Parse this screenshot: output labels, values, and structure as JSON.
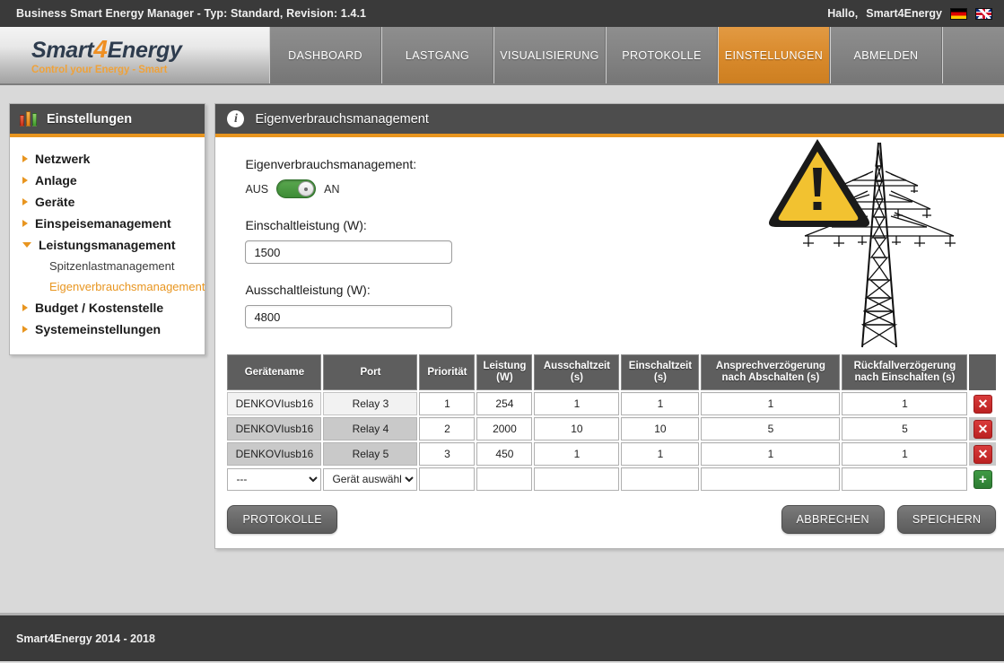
{
  "topbar": {
    "title": "Business Smart Energy Manager - Typ: Standard, Revision: 1.4.1",
    "greeting": "Hallo,",
    "user": "Smart4Energy",
    "flag_de": "german-flag-icon",
    "flag_en": "uk-flag-icon"
  },
  "brand": {
    "name_part1": "Smart",
    "name_four": "4",
    "name_part2": "Energy",
    "tagline": "Control your Energy - Smart"
  },
  "nav": {
    "items": [
      {
        "label": "DASHBOARD",
        "active": false
      },
      {
        "label": "LASTGANG",
        "active": false
      },
      {
        "label": "VISUALISIERUNG",
        "active": false
      },
      {
        "label": "PROTOKOLLE",
        "active": false
      },
      {
        "label": "EINSTELLUNGEN",
        "active": true
      },
      {
        "label": "ABMELDEN",
        "active": false
      }
    ],
    "active_color": "#d98a2c"
  },
  "sidebar": {
    "title": "Einstellungen",
    "icon": "bar-chart-icon",
    "items": [
      {
        "label": "Netzwerk",
        "expanded": false
      },
      {
        "label": "Anlage",
        "expanded": false
      },
      {
        "label": "Geräte",
        "expanded": false
      },
      {
        "label": "Einspeisemanagement",
        "expanded": false
      },
      {
        "label": "Leistungsmanagement",
        "expanded": true
      }
    ],
    "subitems": [
      {
        "label": "Spitzenlastmanagement",
        "active": false
      },
      {
        "label": "Eigenverbrauchsmanagement",
        "active": true
      }
    ],
    "items_after": [
      {
        "label": "Budget / Kostenstelle",
        "expanded": false
      },
      {
        "label": "Systemeinstellungen",
        "expanded": false
      }
    ],
    "accent_color": "#e8951f"
  },
  "content": {
    "title": "Eigenverbrauchsmanagement",
    "icon": "info-icon",
    "form": {
      "toggle_label": "Eigenverbrauchsmanagement:",
      "toggle_off": "AUS",
      "toggle_on": "AN",
      "toggle_state": "on",
      "field1_label": "Einschaltleistung (W):",
      "field1_value": "1500",
      "field2_label": "Ausschaltleistung (W):",
      "field2_value": "4800"
    },
    "graphic": {
      "name": "power-pylon-warning-graphic",
      "warning_color": "#f2c230"
    }
  },
  "table": {
    "headers": [
      "Gerätename",
      "Port",
      "Priorität",
      "Leistung\n(W)",
      "Ausschaltzeit\n(s)",
      "Einschaltzeit\n(s)",
      "Ansprechverzögerung\nnach Abschalten (s)",
      "Rückfallverzögerung\nnach Einschalten (s)"
    ],
    "headers_line1": [
      "Gerätename",
      "Port",
      "Priorität",
      "Leistung",
      "Ausschaltzeit",
      "Einschaltzeit",
      "Ansprechverzögerung",
      "Rückfallverzögerung"
    ],
    "headers_line2": [
      "",
      "",
      "",
      "(W)",
      "(s)",
      "(s)",
      "nach Abschalten (s)",
      "nach Einschalten (s)"
    ],
    "rows": [
      {
        "geraetename": "DENKOVIusb16",
        "port": "Relay 3",
        "prioritaet": "1",
        "leistung": "254",
        "ausschaltzeit": "1",
        "einschaltzeit": "1",
        "ansprechverzoegerung": "1",
        "rueckfallverzoegerung": "1",
        "delete_label": "✕"
      },
      {
        "geraetename": "DENKOVIusb16",
        "port": "Relay 4",
        "prioritaet": "2",
        "leistung": "2000",
        "ausschaltzeit": "10",
        "einschaltzeit": "10",
        "ansprechverzoegerung": "5",
        "rueckfallverzoegerung": "5",
        "delete_label": "✕"
      },
      {
        "geraetename": "DENKOVIusb16",
        "port": "Relay 5",
        "prioritaet": "3",
        "leistung": "450",
        "ausschaltzeit": "1",
        "einschaltzeit": "1",
        "ansprechverzoegerung": "1",
        "rueckfallverzoegerung": "1",
        "delete_label": "✕"
      }
    ],
    "new_row": {
      "device_select_value": "---",
      "port_select_value": "Gerät auswähle",
      "prioritaet": "",
      "leistung": "",
      "ausschaltzeit": "",
      "einschaltzeit": "",
      "ansprechverzoegerung": "",
      "rueckfallverzoegerung": "",
      "add_label": "+"
    }
  },
  "actions": {
    "protokolle": "PROTOKOLLE",
    "abbrechen": "ABBRECHEN",
    "speichern": "SPEICHERN"
  },
  "footer": {
    "text": "Smart4Energy 2014 - 2018"
  }
}
